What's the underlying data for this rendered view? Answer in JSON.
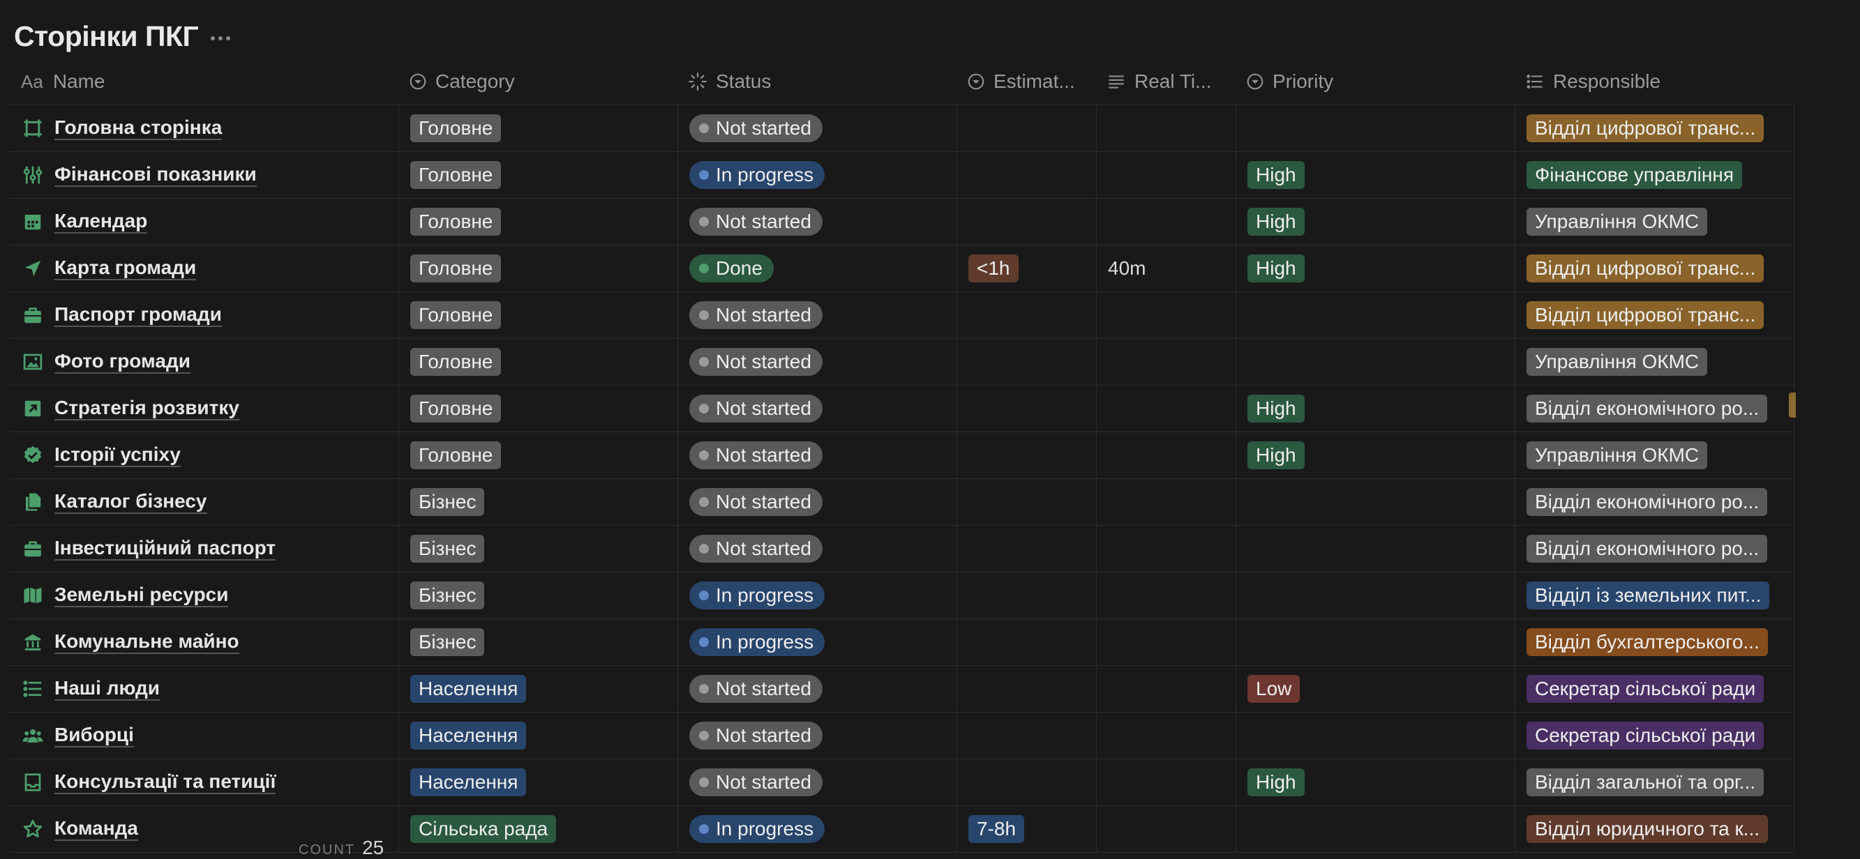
{
  "page": {
    "title": "Сторінки ПКГ"
  },
  "columns": [
    {
      "label": "Name",
      "icon": "text-aa-icon",
      "prefix": "Aa"
    },
    {
      "label": "Category",
      "icon": "select-circle-icon"
    },
    {
      "label": "Status",
      "icon": "status-sun-icon"
    },
    {
      "label": "Estimat...",
      "icon": "select-circle-icon"
    },
    {
      "label": "Real Ti...",
      "icon": "text-lines-icon"
    },
    {
      "label": "Priority",
      "icon": "select-circle-icon"
    },
    {
      "label": "Responsible",
      "icon": "list-icon"
    }
  ],
  "colors": {
    "gray_tag": "#5a5a5a",
    "blue_tag": "#28456c",
    "green_tag": "#2b593f",
    "brown_tag": "#603b2c",
    "orange_tag": "#854c1d",
    "gold_tag": "#89632a",
    "purple_tag": "#492f64",
    "red_tag": "#6e3630",
    "dot_gray": "#9b9b9b",
    "dot_blue": "#5e87c9",
    "dot_green": "#4c9e6b",
    "icon_green": "#4c9e6b"
  },
  "rows": [
    {
      "name": "Головна сторінка",
      "icon": "frame-icon",
      "category": "Головне",
      "category_color": "gray",
      "status": "Not started",
      "estimate": "",
      "real_time": "",
      "priority": "",
      "responsible": "Відділ цифрової транс...",
      "responsible_color": "gold"
    },
    {
      "name": "Фінансові показники",
      "icon": "sliders-icon",
      "category": "Головне",
      "category_color": "gray",
      "status": "In progress",
      "estimate": "",
      "real_time": "",
      "priority": "High",
      "responsible": "Фінансове управління",
      "responsible_color": "green"
    },
    {
      "name": "Календар",
      "icon": "calendar-icon",
      "category": "Головне",
      "category_color": "gray",
      "status": "Not started",
      "estimate": "",
      "real_time": "",
      "priority": "High",
      "responsible": "Управління ОКМС",
      "responsible_color": "gray"
    },
    {
      "name": "Карта громади",
      "icon": "navigation-arrow-icon",
      "category": "Головне",
      "category_color": "gray",
      "status": "Done",
      "estimate": "<1h",
      "estimate_color": "brown",
      "real_time": "40m",
      "priority": "High",
      "responsible": "Відділ цифрової транс...",
      "responsible_color": "gold"
    },
    {
      "name": "Паспорт громади",
      "icon": "briefcase-icon",
      "category": "Головне",
      "category_color": "gray",
      "status": "Not started",
      "estimate": "",
      "real_time": "",
      "priority": "",
      "responsible": "Відділ цифрової транс...",
      "responsible_color": "gold"
    },
    {
      "name": "Фото громади",
      "icon": "image-icon",
      "category": "Головне",
      "category_color": "gray",
      "status": "Not started",
      "estimate": "",
      "real_time": "",
      "priority": "",
      "responsible": "Управління ОКМС",
      "responsible_color": "gray"
    },
    {
      "name": "Стратегія розвитку",
      "icon": "arrow-up-right-box-icon",
      "category": "Головне",
      "category_color": "gray",
      "status": "Not started",
      "estimate": "",
      "real_time": "",
      "priority": "High",
      "responsible": "Відділ економічного ро...",
      "responsible_color": "gray"
    },
    {
      "name": "Історії успіху",
      "icon": "verified-badge-icon",
      "category": "Головне",
      "category_color": "gray",
      "status": "Not started",
      "estimate": "",
      "real_time": "",
      "priority": "High",
      "responsible": "Управління ОКМС",
      "responsible_color": "gray"
    },
    {
      "name": "Каталог бізнесу",
      "icon": "documents-icon",
      "category": "Бізнес",
      "category_color": "gray",
      "status": "Not started",
      "estimate": "",
      "real_time": "",
      "priority": "",
      "responsible": "Відділ економічного ро...",
      "responsible_color": "gray"
    },
    {
      "name": "Інвестиційний паспорт",
      "icon": "briefcase-icon",
      "category": "Бізнес",
      "category_color": "gray",
      "status": "Not started",
      "estimate": "",
      "real_time": "",
      "priority": "",
      "responsible": "Відділ економічного ро...",
      "responsible_color": "gray"
    },
    {
      "name": "Земельні ресурси",
      "icon": "map-icon",
      "category": "Бізнес",
      "category_color": "gray",
      "status": "In progress",
      "estimate": "",
      "real_time": "",
      "priority": "",
      "responsible": "Відділ із земельних пит...",
      "responsible_color": "blue"
    },
    {
      "name": "Комунальне майно",
      "icon": "building-icon",
      "category": "Бізнес",
      "category_color": "gray",
      "status": "In progress",
      "estimate": "",
      "real_time": "",
      "priority": "",
      "responsible": "Відділ бухгалтерського...",
      "responsible_color": "orange"
    },
    {
      "name": "Наші люди",
      "icon": "list-bullets-icon",
      "category": "Населення",
      "category_color": "blue",
      "status": "Not started",
      "estimate": "",
      "real_time": "",
      "priority": "Low",
      "responsible": "Секретар сільської ради",
      "responsible_color": "purple"
    },
    {
      "name": "Виборці",
      "icon": "people-icon",
      "category": "Населення",
      "category_color": "blue",
      "status": "Not started",
      "estimate": "",
      "real_time": "",
      "priority": "",
      "responsible": "Секретар сільської ради",
      "responsible_color": "purple"
    },
    {
      "name": "Консультації та петиції",
      "icon": "inbox-icon",
      "category": "Населення",
      "category_color": "blue",
      "status": "Not started",
      "estimate": "",
      "real_time": "",
      "priority": "High",
      "responsible": "Відділ загальної та орг...",
      "responsible_color": "gray"
    },
    {
      "name": "Команда",
      "icon": "star-icon",
      "category": "Сільська рада",
      "category_color": "green",
      "status": "In progress",
      "estimate": "7-8h",
      "estimate_color": "blue",
      "real_time": "",
      "priority": "",
      "responsible": "Відділ юридичного та к...",
      "responsible_color": "brown"
    }
  ],
  "footer": {
    "count_label": "COUNT",
    "count_value": "25"
  }
}
